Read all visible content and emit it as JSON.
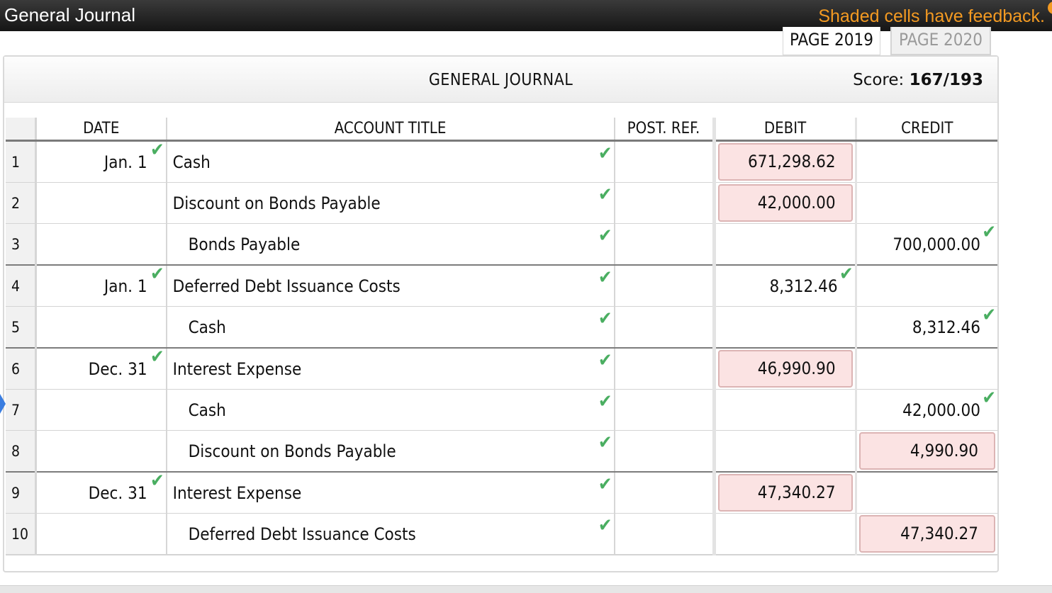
{
  "app": {
    "title": "General Journal",
    "feedback_note": "Shaded cells have feedback."
  },
  "tabs": [
    {
      "label": "PAGE 2019",
      "active": true
    },
    {
      "label": "PAGE 2020",
      "active": false
    }
  ],
  "journal": {
    "title": "GENERAL JOURNAL",
    "score_label": "Score:",
    "score_value": "167/193",
    "columns": [
      "DATE",
      "ACCOUNT TITLE",
      "POST. REF.",
      "DEBIT",
      "CREDIT"
    ]
  },
  "rows": [
    {
      "num": "1",
      "date": "Jan. 1",
      "account": "Cash",
      "indent": false,
      "post_ref": "",
      "debit": "671,298.62",
      "credit": ""
    },
    {
      "num": "2",
      "date": "",
      "account": "Discount on Bonds Payable",
      "indent": false,
      "post_ref": "",
      "debit": "42,000.00",
      "credit": ""
    },
    {
      "num": "3",
      "date": "",
      "account": "Bonds Payable",
      "indent": true,
      "post_ref": "",
      "debit": "",
      "credit": "700,000.00"
    },
    {
      "num": "4",
      "date": "Jan. 1",
      "account": "Deferred Debt Issuance Costs",
      "indent": false,
      "post_ref": "",
      "debit": "8,312.46",
      "credit": ""
    },
    {
      "num": "5",
      "date": "",
      "account": "Cash",
      "indent": true,
      "post_ref": "",
      "debit": "",
      "credit": "8,312.46"
    },
    {
      "num": "6",
      "date": "Dec. 31",
      "account": "Interest Expense",
      "indent": false,
      "post_ref": "",
      "debit": "46,990.90",
      "credit": ""
    },
    {
      "num": "7",
      "date": "",
      "account": "Cash",
      "indent": true,
      "post_ref": "",
      "debit": "",
      "credit": "42,000.00"
    },
    {
      "num": "8",
      "date": "",
      "account": "Discount on Bonds Payable",
      "indent": true,
      "post_ref": "",
      "debit": "",
      "credit": "4,990.90"
    },
    {
      "num": "9",
      "date": "Dec. 31",
      "account": "Interest Expense",
      "indent": false,
      "post_ref": "",
      "debit": "47,340.27",
      "credit": ""
    },
    {
      "num": "10",
      "date": "",
      "account": "Deferred Debt Issuance Costs",
      "indent": true,
      "post_ref": "",
      "debit": "",
      "credit": "47,340.27"
    }
  ],
  "colors": {
    "correct": "#4aae61",
    "feedback_shade": "#fbe3e3",
    "feedback_text": "#f39a22"
  },
  "icons": {
    "correct": "checkmark-icon"
  }
}
